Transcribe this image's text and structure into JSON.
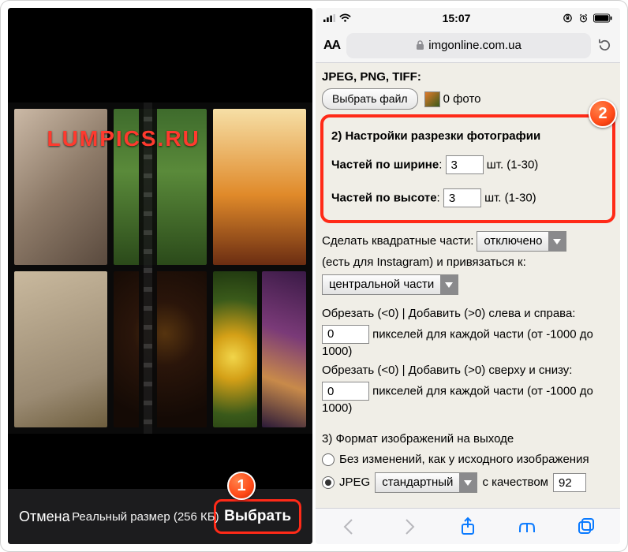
{
  "left": {
    "brand": "LUMPICS.RU",
    "cancel": "Отмена",
    "size_label": "Реальный размер (256 КБ)",
    "choose": "Выбрать",
    "callout": "1"
  },
  "right": {
    "status": {
      "time": "15:07"
    },
    "url_bar": {
      "aa": "AA",
      "domain": "imgonline.com.ua"
    },
    "top_line": "JPEG, PNG, TIFF:",
    "pick_file": "Выбрать файл",
    "photo_count": "0 фото",
    "callout": "2",
    "section2": {
      "title": "2) Настройки разрезки фотографии",
      "width_label": "Частей по ширине",
      "width_value": "3",
      "height_label": "Частей по высоте",
      "height_value": "3",
      "unit_hint": "шт. (1-30)"
    },
    "square": {
      "label_a": "Сделать квадратные части:",
      "select": "отключено",
      "suffix": "(есть для Instagram) и привязаться к:",
      "anchor_select": "центральной части"
    },
    "crop": {
      "lr_label": "Обрезать (<0) | Добавить (>0) слева и справа:",
      "lr_value": "0",
      "px_hint": "пикселей для каждой части (от -1000 до 1000)",
      "tb_label": "Обрезать (<0) | Добавить (>0) сверху и снизу:",
      "tb_value": "0"
    },
    "section3": {
      "title": "3) Формат изображений на выходе",
      "opt_nochange": "Без изменений, как у исходного изображения",
      "opt_jpeg": "JPEG",
      "jpeg_select": "стандартный",
      "quality_label": "с качеством",
      "quality_value": "92"
    }
  }
}
